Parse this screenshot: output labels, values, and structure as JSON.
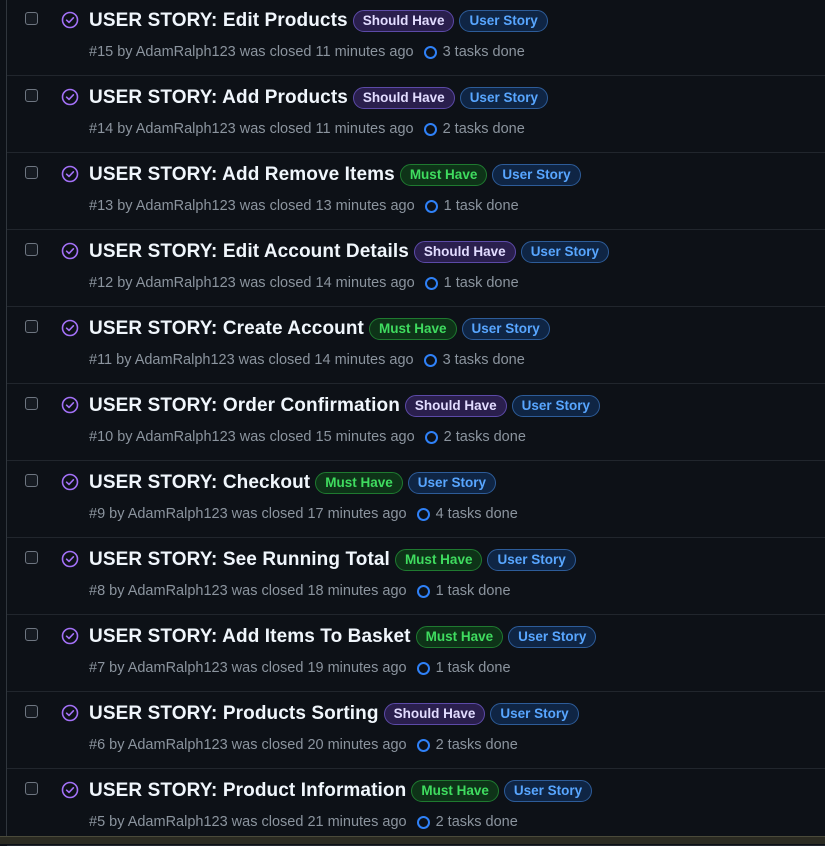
{
  "issues": [
    {
      "title": "USER STORY: Edit Products",
      "priority": "Should Have",
      "type": "User Story",
      "meta": "#15 by AdamRalph123 was closed 11 minutes ago",
      "tasks": "3 tasks done"
    },
    {
      "title": "USER STORY: Add Products",
      "priority": "Should Have",
      "type": "User Story",
      "meta": "#14 by AdamRalph123 was closed 11 minutes ago",
      "tasks": "2 tasks done"
    },
    {
      "title": "USER STORY: Add Remove Items",
      "priority": "Must Have",
      "type": "User Story",
      "meta": "#13 by AdamRalph123 was closed 13 minutes ago",
      "tasks": "1 task done"
    },
    {
      "title": "USER STORY: Edit Account Details",
      "priority": "Should Have",
      "type": "User Story",
      "meta": "#12 by AdamRalph123 was closed 14 minutes ago",
      "tasks": "1 task done"
    },
    {
      "title": "USER STORY: Create Account",
      "priority": "Must Have",
      "type": "User Story",
      "meta": "#11 by AdamRalph123 was closed 14 minutes ago",
      "tasks": "3 tasks done"
    },
    {
      "title": "USER STORY: Order Confirmation",
      "priority": "Should Have",
      "type": "User Story",
      "meta": "#10 by AdamRalph123 was closed 15 minutes ago",
      "tasks": "2 tasks done"
    },
    {
      "title": "USER STORY: Checkout",
      "priority": "Must Have",
      "type": "User Story",
      "meta": "#9 by AdamRalph123 was closed 17 minutes ago",
      "tasks": "4 tasks done"
    },
    {
      "title": "USER STORY: See Running Total",
      "priority": "Must Have",
      "type": "User Story",
      "meta": "#8 by AdamRalph123 was closed 18 minutes ago",
      "tasks": "1 task done"
    },
    {
      "title": "USER STORY: Add Items To Basket",
      "priority": "Must Have",
      "type": "User Story",
      "meta": "#7 by AdamRalph123 was closed 19 minutes ago",
      "tasks": "1 task done"
    },
    {
      "title": "USER STORY: Products Sorting",
      "priority": "Should Have",
      "type": "User Story",
      "meta": "#6 by AdamRalph123 was closed 20 minutes ago",
      "tasks": "2 tasks done"
    },
    {
      "title": "USER STORY: Product Information",
      "priority": "Must Have",
      "type": "User Story",
      "meta": "#5 by AdamRalph123 was closed 21 minutes ago",
      "tasks": "2 tasks done"
    }
  ],
  "icons": {
    "state": "closed-issue-check-icon",
    "tasks": "task-progress-ring-icon"
  },
  "colors": {
    "background": "#0d1117",
    "closed_icon": "#a371f7",
    "should_have": "#2a1f4d",
    "must_have": "#3fdc5f",
    "user_story": "#58a6ff",
    "task_ring": "#2f81f7"
  }
}
